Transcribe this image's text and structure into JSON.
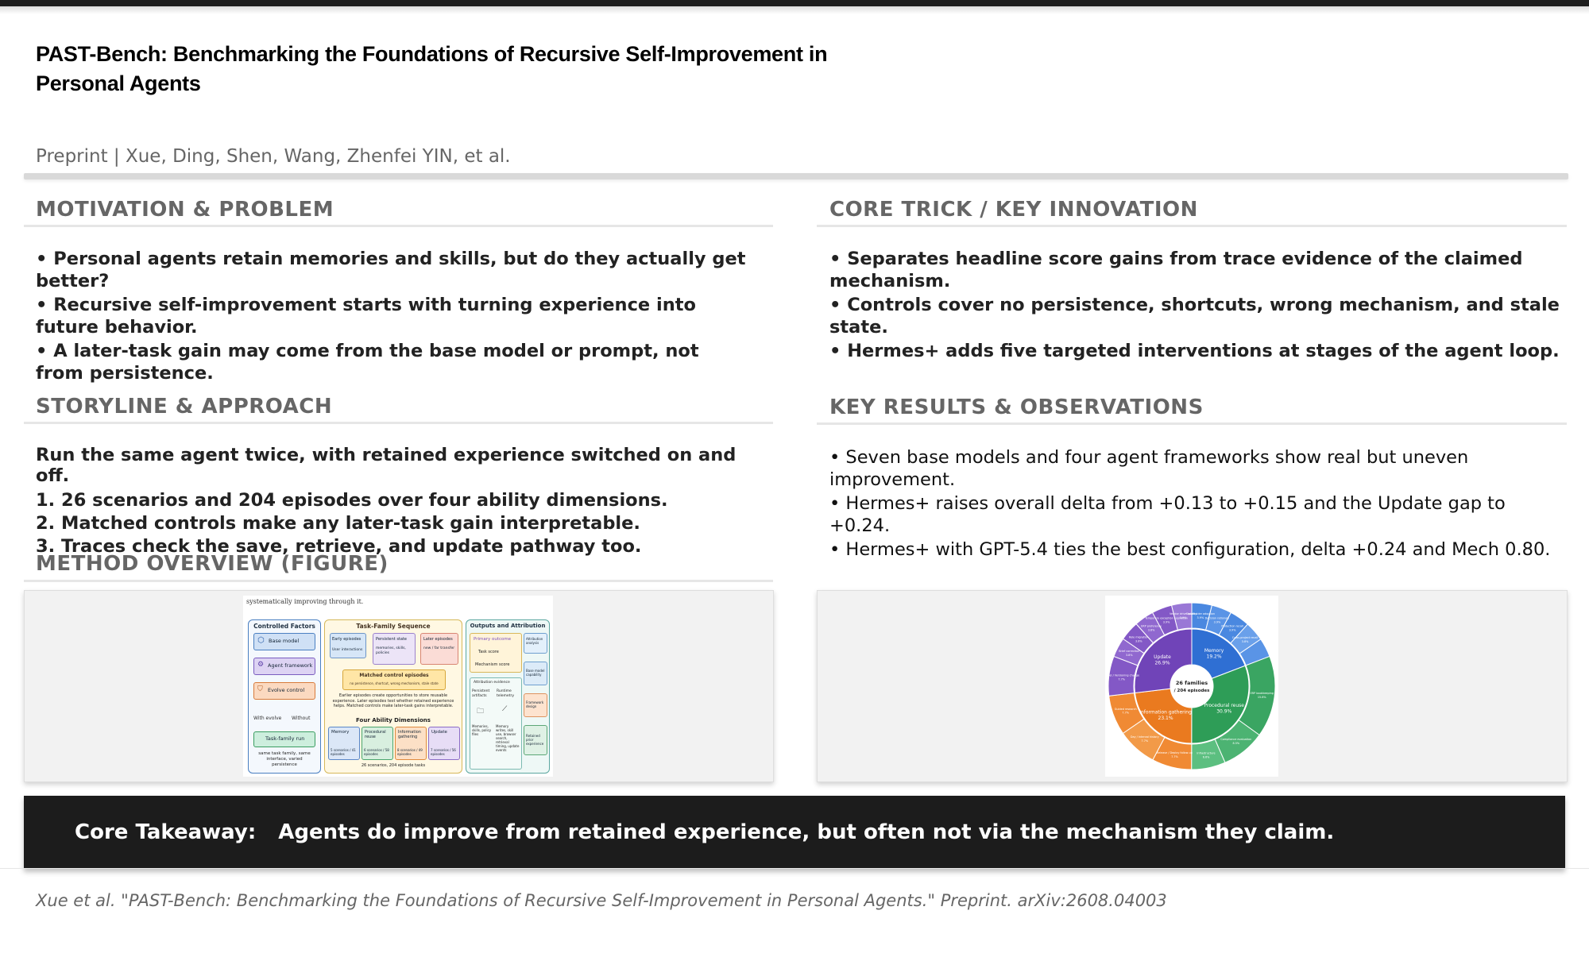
{
  "paper": {
    "title": "PAST-Bench: Benchmarking the Foundations of Recursive Self-Improvement in Personal Agents",
    "authors": "Preprint | Xue, Ding, Shen, Wang, Zhenfei YIN, et al."
  },
  "motivation": {
    "heading": "MOTIVATION & PROBLEM",
    "items": [
      "•  Personal agents retain memories and skills, but do they actually get better?",
      "•  Recursive self-improvement starts with turning experience into future behavior.",
      "•  A later-task gain may come from the base model or prompt, not from persistence."
    ]
  },
  "core_trick": {
    "heading": "CORE TRICK / KEY INNOVATION",
    "items": [
      "•  Separates headline score gains from trace evidence of the claimed mechanism.",
      "•  Controls cover no persistence, shortcuts, wrong mechanism, and stale state.",
      "•  Hermes+ adds five targeted interventions at stages of the agent loop."
    ]
  },
  "storyline": {
    "heading": "STORYLINE & APPROACH",
    "lead": "Run the same agent twice, with retained experience switched on and off.",
    "steps": [
      "1. 26 scenarios and 204 episodes over four ability dimensions.",
      "2. Matched controls make any later-task gain interpretable.",
      "3. Traces check the save, retrieve, and update pathway too."
    ]
  },
  "results": {
    "heading": "KEY RESULTS & OBSERVATIONS",
    "items": [
      "•  Seven base models and four agent frameworks show real but uneven improvement.",
      "•  Hermes+ raises overall delta from +0.13 to +0.15 and the Update gap to +0.24.",
      "•  Hermes+ with GPT-5.4 ties the best configuration, delta +0.24 and Mech 0.80."
    ]
  },
  "method_overview": {
    "heading": "METHOD OVERVIEW (FIGURE)",
    "caption_top": "systematically improving through it.",
    "controlled_factors": {
      "title": "Controlled Factors",
      "items": [
        "Base model",
        "Agent framework",
        "Evolve control"
      ],
      "with_label": "With evolve",
      "without_label": "Without",
      "run_label": "Task-family run",
      "note": "same task family, same interface, varied persistence"
    },
    "task_family": {
      "title": "Task-Family Sequence",
      "boxes": [
        "Early episodes",
        "Persistent state",
        "Later episodes"
      ],
      "subs": [
        "User interactions",
        "memories, skills, policies",
        "new / far transfer"
      ],
      "matched_title": "Matched control episodes",
      "matched_sub": "no persistence, shortcut, wrong mechanism, stale state",
      "explain": "Earlier episodes create opportunities to store reusable experience. Later episodes test whether retained experience helps. Matched controls make later-task gains interpretable.",
      "ability_title": "Four Ability Dimensions",
      "abilities": [
        "Memory",
        "Procedural reuse",
        "Information gathering",
        "Update"
      ],
      "ability_counts": [
        "5 scenarios / 41 episodes",
        "6 scenarios / 58 episodes",
        "8 scenarios / 49 episodes",
        "7 scenarios / 56 episodes"
      ],
      "footer": "26 scenarios, 204 episode tasks"
    },
    "outputs": {
      "title": "Outputs and Attribution",
      "primary": "Primary outcome",
      "task_score": "Task score",
      "mech_score": "Mechanism score",
      "attr_title": "Attribution evidence",
      "persist": "Persistent artifacts",
      "telemetry": "Runtime telemetry",
      "side": [
        "Attribution analysis",
        "Base model capability",
        "Framework design",
        "Retained prior experience"
      ],
      "footnotes": [
        "Memories, skills, policy files",
        "Memory writes, skill use, browser search, retrieval timing, update events"
      ]
    }
  },
  "sunburst": {
    "center_line1": "26 families",
    "center_line2": "/ 204 episodes",
    "inner": [
      {
        "label": "Memory",
        "pct": "19.2%",
        "value": 19.2,
        "color": "#2f6fd3"
      },
      {
        "label": "Procedural reuse",
        "pct": "30.9%",
        "value": 30.9,
        "color": "#2e9d57"
      },
      {
        "label": "Information gathering",
        "pct": "23.1%",
        "value": 23.1,
        "color": "#ea7a1f"
      },
      {
        "label": "Update",
        "pct": "26.9%",
        "value": 26.9,
        "color": "#7044b8"
      }
    ],
    "outer": [
      {
        "label": "Stakeholder adoption",
        "pct": "3.9%",
        "value": 3.9,
        "color": "#4a88e0"
      },
      {
        "label": "Decision rationale",
        "pct": "3.9%",
        "value": 3.9,
        "color": "#5a94e6"
      },
      {
        "label": "Protection recall",
        "pct": "3.9%",
        "value": 3.9,
        "color": "#4a88e0"
      },
      {
        "label": "Cross-project recall",
        "pct": "3.8%",
        "value": 3.8,
        "color": "#6aa0ea"
      },
      {
        "label": "",
        "pct": "",
        "value": 3.7,
        "color": "#5a94e6"
      },
      {
        "label": "ERP bookkeeping",
        "pct": "15.8%",
        "value": 15.8,
        "color": "#3aa562"
      },
      {
        "label": "Compliance evaluation",
        "pct": "8.5%",
        "value": 8.5,
        "color": "#4cb372"
      },
      {
        "label": "Infrastructure",
        "pct": "6.6%",
        "value": 6.6,
        "color": "#5cbf80"
      },
      {
        "label": "Release / Deploy follow-up",
        "pct": "7.7%",
        "value": 7.7,
        "color": "#f08a34"
      },
      {
        "label": "Day / Interval history",
        "pct": "7.7%",
        "value": 7.7,
        "color": "#f29a48"
      },
      {
        "label": "Guided research",
        "pct": "7.7%",
        "value": 7.7,
        "color": "#f08a34"
      },
      {
        "label": "Model / Versioning change",
        "pct": "7.7%",
        "value": 7.7,
        "color": "#8358c6"
      },
      {
        "label": "Brief correction",
        "pct": "3.8%",
        "value": 3.8,
        "color": "#9068cf"
      },
      {
        "label": "Role migration",
        "pct": "3.8%",
        "value": 3.8,
        "color": "#8358c6"
      },
      {
        "label": "ERP preference",
        "pct": "3.8%",
        "value": 3.8,
        "color": "#9068cf"
      },
      {
        "label": "Temporary exception expiration",
        "pct": "3.9%",
        "value": 3.9,
        "color": "#8358c6"
      },
      {
        "label": "Vendor drive quality",
        "pct": "3.9%",
        "value": 3.9,
        "color": "#9a78d6"
      }
    ]
  },
  "takeaway": {
    "label": "Core Takeaway:",
    "text": "Agents do improve from retained experience, but often not via the mechanism they claim."
  },
  "citation": "Xue et al. \"PAST-Bench: Benchmarking the Foundations of Recursive Self-Improvement in Personal Agents.\" Preprint. arXiv:2608.04003"
}
